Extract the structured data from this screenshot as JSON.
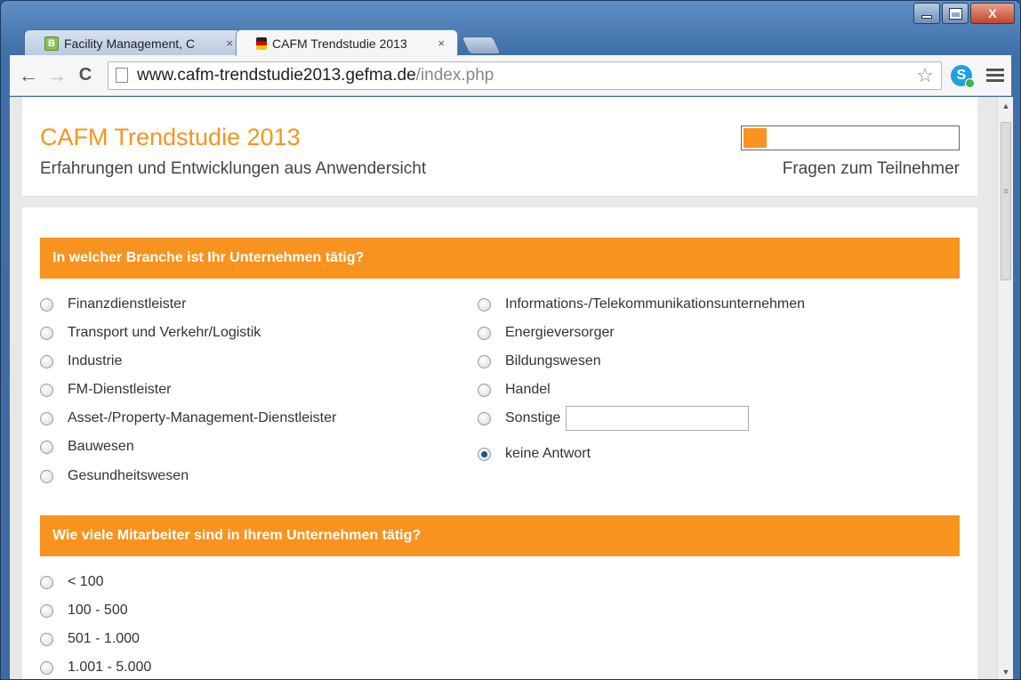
{
  "window": {
    "controls": {
      "minimize": "–",
      "maximize": "□",
      "close": "X"
    }
  },
  "tabs": [
    {
      "label": "Facility Management, C",
      "close": "×",
      "favicon": "green-b-icon"
    },
    {
      "label": "CAFM Trendstudie 2013",
      "close": "×",
      "favicon": "flag-icon"
    }
  ],
  "toolbar": {
    "back": "←",
    "forward": "→",
    "reload": "C",
    "url_host": "www.cafm-trendstudie2013.gefma.de",
    "url_path": "/index.php",
    "star": "☆",
    "extension_letter": "S"
  },
  "header": {
    "title": "CAFM Trendstudie 2013",
    "subtitle": "Erfahrungen und Entwicklungen aus Anwendersicht",
    "progress_percent": 11,
    "progress_label": "Fragen zum Teilnehmer"
  },
  "questions": [
    {
      "title": "In welcher Branche ist Ihr Unternehmen tätig?",
      "left_options": [
        "Finanzdienstleister",
        "Transport und Verkehr/Logistik",
        "Industrie",
        "FM-Dienstleister",
        "Asset-/Property-Management-Dienstleister",
        "Bauwesen",
        "Gesundheitswesen"
      ],
      "right_options": [
        "Informations-/Telekommunikationsunternehmen",
        "Energieversorger",
        "Bildungswesen",
        "Handel",
        "Sonstige",
        "keine Antwort"
      ],
      "selected": "keine Antwort",
      "other_value": ""
    },
    {
      "title": "Wie viele Mitarbeiter sind in Ihrem Unternehmen tätig?",
      "options": [
        "< 100",
        "100 - 500",
        "501 - 1.000",
        "1.001 - 5.000"
      ]
    }
  ],
  "colors": {
    "accent": "#f7931e",
    "radio_checked": "#1e4f8a"
  }
}
